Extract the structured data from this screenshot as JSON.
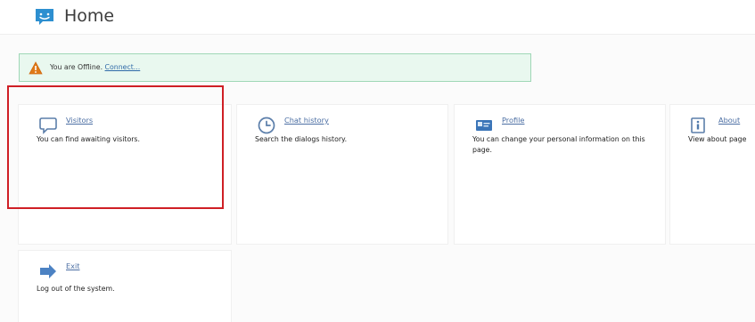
{
  "header": {
    "title": "Home",
    "icon": "chat-bubble-face-icon"
  },
  "notice": {
    "text": "You are Offline.",
    "link_label": "Connect...",
    "icon": "warning-icon",
    "background_color": "#e9f8ef",
    "border_color": "#9fd7b6"
  },
  "tiles": [
    {
      "title": "Visitors",
      "description": "You can find awaiting visitors.",
      "icon": "speech-bubble-icon"
    },
    {
      "title": "Chat history",
      "description": "Search the dialogs history.",
      "icon": "clock-icon"
    },
    {
      "title": "Profile",
      "description": "You can change your personal information on this page.",
      "icon": "profile-card-icon"
    },
    {
      "title": "About",
      "description": "View about page",
      "icon": "info-icon"
    },
    {
      "title": "Exit",
      "description": "Log out of the system.",
      "icon": "arrow-right-icon"
    }
  ],
  "highlight": {
    "target": "Visitors",
    "color": "#cf1f25"
  }
}
